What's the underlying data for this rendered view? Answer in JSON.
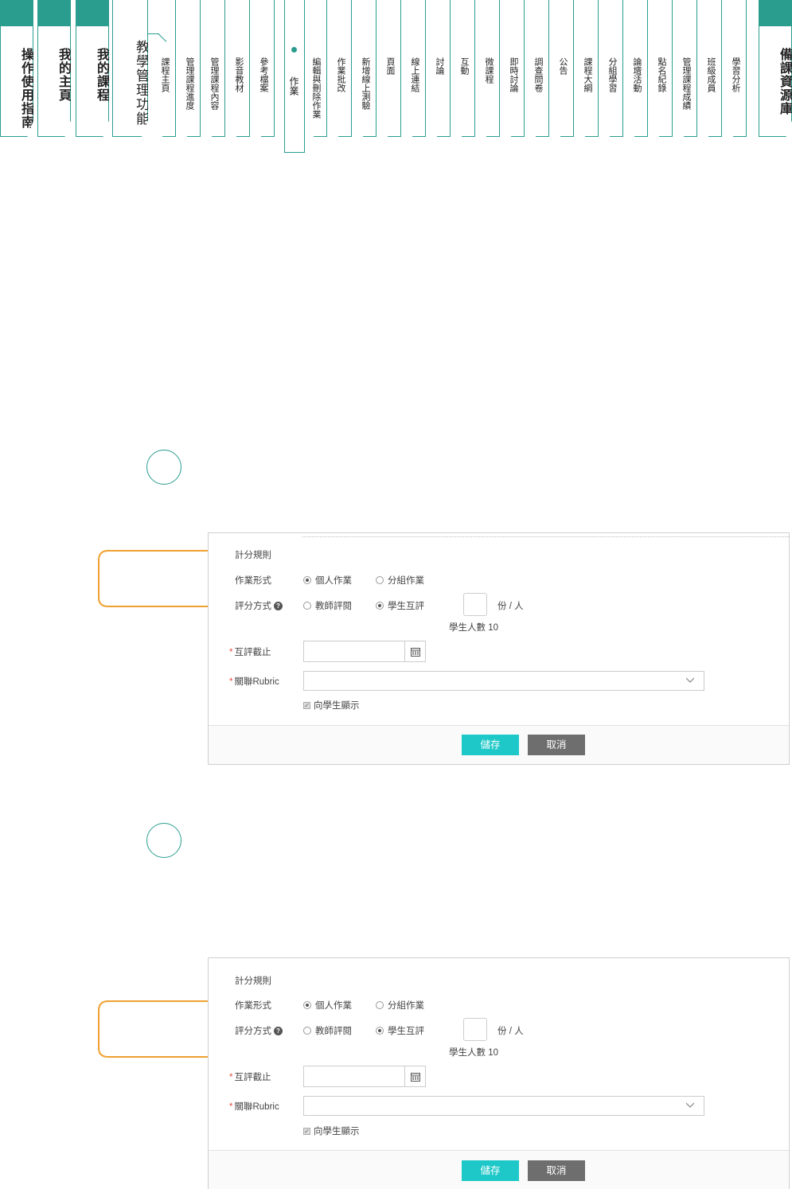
{
  "main_tabs": [
    {
      "label": "操作使用指南"
    },
    {
      "label": "我的主頁"
    },
    {
      "label": "我的課程"
    },
    {
      "label": "教學管理功能"
    }
  ],
  "sub_tabs": [
    {
      "label": "課程主頁"
    },
    {
      "label": "管理課程進度"
    },
    {
      "label": "管理課程內容"
    },
    {
      "label": "影音教材"
    },
    {
      "label": "參考檔案"
    },
    {
      "label": "作業",
      "active": true
    },
    {
      "label": "編輯與刪除作業"
    },
    {
      "label": "作業批改"
    },
    {
      "label": "新增線上測驗"
    },
    {
      "label": "頁面"
    },
    {
      "label": "線上連結"
    },
    {
      "label": "討論"
    },
    {
      "label": "互動"
    },
    {
      "label": "微課程"
    },
    {
      "label": "即時討論"
    },
    {
      "label": "調查問卷"
    },
    {
      "label": "公告"
    },
    {
      "label": "課程大綱"
    },
    {
      "label": "分組學習"
    },
    {
      "label": "論壇活動"
    },
    {
      "label": "點名紀錄"
    },
    {
      "label": "管理課程成績"
    },
    {
      "label": "班級成員"
    },
    {
      "label": "學習分析"
    }
  ],
  "right_tab": {
    "label": "備課資源庫"
  },
  "form": {
    "section_title": "計分規則",
    "assignment_type_label": "作業形式",
    "individual_option": "個人作業",
    "group_option": "分組作業",
    "grading_method_label": "評分方式",
    "teacher_option": "教師評閱",
    "peer_option": "學生互評",
    "per_person_suffix": "份 / 人",
    "student_count": "學生人數 10",
    "required_mark": "*",
    "peer_deadline_label": "互評截止",
    "rubric_label": "關聯Rubric",
    "show_to_students": "向學生顯示",
    "save_label": "儲存",
    "cancel_label": "取消"
  },
  "colors": {
    "accent": "#2a9d8f",
    "callout": "#f0a030",
    "save": "#1fc8c8",
    "cancel": "#6e6e6e"
  }
}
